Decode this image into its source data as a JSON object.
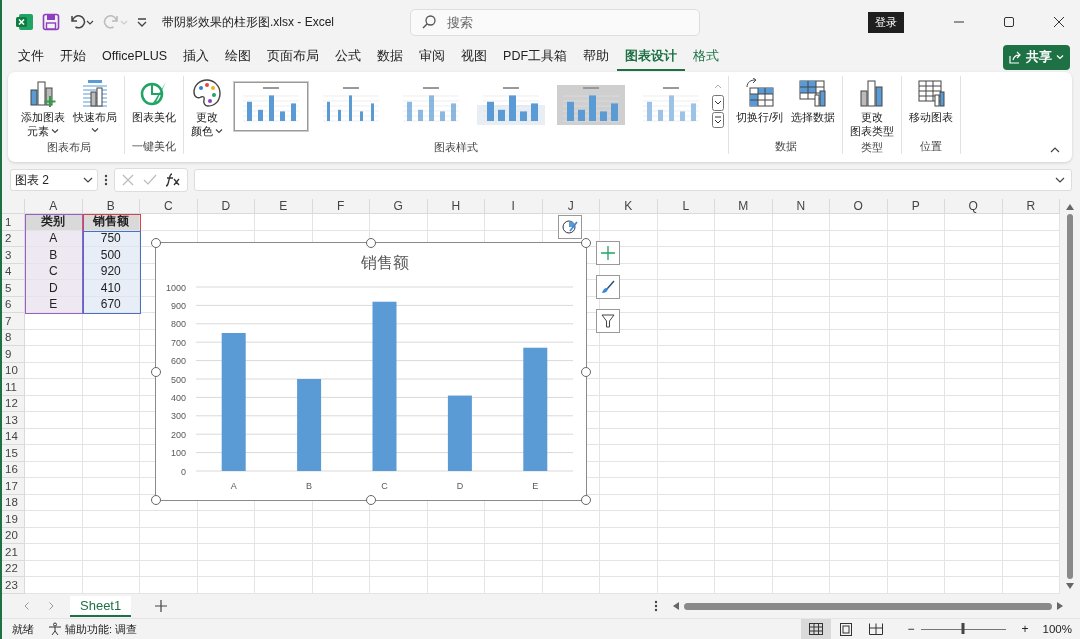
{
  "window": {
    "title": "带阴影效果的柱形图.xlsx  -  Excel",
    "search_placeholder": "搜索",
    "login": "登录"
  },
  "menu_tabs": [
    {
      "label": "文件",
      "selected": false,
      "contextual": false
    },
    {
      "label": "开始",
      "selected": false,
      "contextual": false
    },
    {
      "label": "OfficePLUS",
      "selected": false,
      "contextual": false
    },
    {
      "label": "插入",
      "selected": false,
      "contextual": false
    },
    {
      "label": "绘图",
      "selected": false,
      "contextual": false
    },
    {
      "label": "页面布局",
      "selected": false,
      "contextual": false
    },
    {
      "label": "公式",
      "selected": false,
      "contextual": false
    },
    {
      "label": "数据",
      "selected": false,
      "contextual": false
    },
    {
      "label": "审阅",
      "selected": false,
      "contextual": false
    },
    {
      "label": "视图",
      "selected": false,
      "contextual": false
    },
    {
      "label": "PDF工具箱",
      "selected": false,
      "contextual": false
    },
    {
      "label": "帮助",
      "selected": false,
      "contextual": false
    },
    {
      "label": "图表设计",
      "selected": true,
      "contextual": true
    },
    {
      "label": "格式",
      "selected": false,
      "contextual": true
    }
  ],
  "share": "共享",
  "ribbon": {
    "groups": [
      {
        "label": "图表布局",
        "buttons": [
          {
            "kind": "add-element",
            "lines": [
              "添加图表",
              "元素"
            ],
            "dropdown": true
          },
          {
            "kind": "quick-layout",
            "lines": [
              "快速布局"
            ],
            "dropdown": true
          }
        ]
      },
      {
        "label": "一键美化",
        "buttons": [
          {
            "kind": "beautify",
            "lines": [
              "图表美化"
            ],
            "dropdown": false
          }
        ]
      },
      {
        "label": "图表样式",
        "buttons": [
          {
            "kind": "palette",
            "lines": [
              "更改",
              "颜色"
            ],
            "dropdown": true
          }
        ],
        "gallery": [
          {
            "selected": true
          },
          {
            "selected": false
          },
          {
            "selected": false
          },
          {
            "selected": false
          },
          {
            "selected": false
          },
          {
            "selected": false
          }
        ]
      },
      {
        "label": "数据",
        "buttons": [
          {
            "kind": "switch",
            "lines": [
              "切换行/列"
            ],
            "dropdown": false
          },
          {
            "kind": "select-data",
            "lines": [
              "选择数据"
            ],
            "dropdown": false
          }
        ]
      },
      {
        "label": "类型",
        "buttons": [
          {
            "kind": "change-type",
            "lines": [
              "更改",
              "图表类型"
            ],
            "dropdown": false
          }
        ]
      },
      {
        "label": "位置",
        "buttons": [
          {
            "kind": "move",
            "lines": [
              "移动图表"
            ],
            "dropdown": false
          }
        ]
      }
    ]
  },
  "name_box": "图表 2",
  "sheet": {
    "columns": [
      "A",
      "B",
      "C",
      "D",
      "E",
      "F",
      "G",
      "H",
      "I",
      "J",
      "K",
      "L",
      "M",
      "N",
      "O",
      "P",
      "Q",
      "R"
    ],
    "row_numbers": [
      "1",
      "2",
      "3",
      "4",
      "5",
      "6",
      "7",
      "8",
      "9",
      "10",
      "11",
      "12",
      "13",
      "14",
      "15",
      "16",
      "17",
      "18",
      "19",
      "20",
      "21",
      "22",
      "23"
    ],
    "cells": [
      [
        "类别",
        "销售额"
      ],
      [
        "A",
        "750"
      ],
      [
        "B",
        "500"
      ],
      [
        "C",
        "920"
      ],
      [
        "D",
        "410"
      ],
      [
        "E",
        "670"
      ]
    ]
  },
  "chart": {
    "chart_data": {
      "type": "bar",
      "title": "销售额",
      "categories": [
        "A",
        "B",
        "C",
        "D",
        "E"
      ],
      "series": [
        {
          "color": "#5b9bd5",
          "values": [
            750,
            500,
            920,
            410,
            670
          ]
        }
      ],
      "grid": true,
      "ylim": [
        0,
        1000
      ],
      "yticks": [
        0,
        100,
        200,
        300,
        400,
        500,
        600,
        700,
        800,
        900,
        1000
      ]
    }
  },
  "sheet_tabs": [
    {
      "label": "Sheet1",
      "selected": true
    }
  ],
  "status_bar": {
    "status": "就绪",
    "accessibility": "辅助功能: 调查",
    "views": [
      {
        "kind": "normal",
        "selected": true
      },
      {
        "kind": "page-layout",
        "selected": false
      },
      {
        "kind": "page-break",
        "selected": false
      }
    ],
    "zoom": {
      "level": 0.5,
      "minus": "−",
      "plus": "+",
      "reading": "100%"
    }
  }
}
